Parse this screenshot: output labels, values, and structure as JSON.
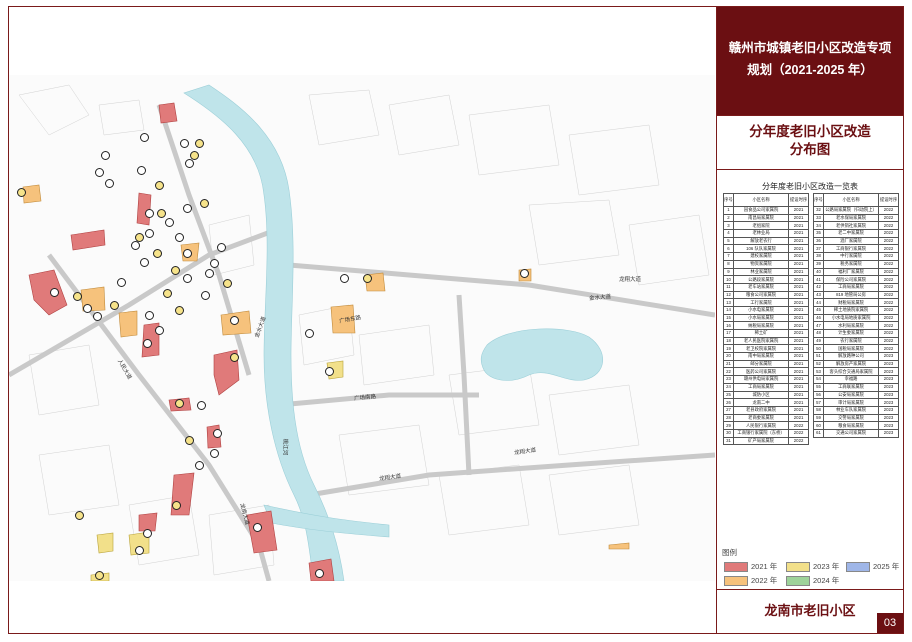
{
  "header": {
    "title": "赣州市城镇老旧小区改造专项规划（2021-2025 年）",
    "subtitle_line1": "分年度老旧小区改造",
    "subtitle_line2": "分布图"
  },
  "table": {
    "caption": "分年度老旧小区改造一览表",
    "col_no": "序号",
    "col_name": "小区名称",
    "col_year": "提设时序",
    "left_rows": [
      [
        "1",
        "园食品公司家属院",
        "2021"
      ],
      [
        "2",
        "南昌局家属院",
        "2021"
      ],
      [
        "3",
        "老组家院",
        "2021"
      ],
      [
        "4",
        "老林业局",
        "2021"
      ],
      [
        "5",
        "解放老农行",
        "2021"
      ],
      [
        "6",
        "106 队队家属院",
        "2021"
      ],
      [
        "7",
        "建校家属院",
        "2021"
      ],
      [
        "8",
        "物资家属院",
        "2021"
      ],
      [
        "9",
        "林业家属院",
        "2021"
      ],
      [
        "10",
        "公路段家属院",
        "2021"
      ],
      [
        "11",
        "老车站家属院",
        "2021"
      ],
      [
        "12",
        "粮食公司家属院",
        "2021"
      ],
      [
        "13",
        "工行家属院",
        "2021"
      ],
      [
        "14",
        "小水电家属院",
        "2021"
      ],
      [
        "15",
        "小水局家属院",
        "2021"
      ],
      [
        "16",
        "纳税局家属院",
        "2021"
      ],
      [
        "17",
        "稀土矿",
        "2021"
      ],
      [
        "18",
        "老人民医院家属院",
        "2021"
      ],
      [
        "19",
        "老卫校院家属院",
        "2021"
      ],
      [
        "20",
        "南中局家属院",
        "2021"
      ],
      [
        "21",
        "邮分家属院",
        "2021"
      ],
      [
        "22",
        "医药公司家属院",
        "2021"
      ],
      [
        "23",
        "赣州供电局家属院",
        "2021"
      ],
      [
        "24",
        "工商局家属院",
        "2021"
      ],
      [
        "25",
        "城防小区",
        "2021"
      ],
      [
        "26",
        "龙南二中",
        "2021"
      ],
      [
        "27",
        "老县政府家属院",
        "2021"
      ],
      [
        "28",
        "老商委家属院",
        "2021"
      ],
      [
        "29",
        "人民银行家属院",
        "2022"
      ],
      [
        "30",
        "工商银行家属院（东桥）",
        "2022"
      ],
      [
        "31",
        "矿产局家属院",
        "2022"
      ]
    ],
    "right_rows": [
      [
        "32",
        "公路局家属院（归动院上）",
        "2022"
      ],
      [
        "33",
        "老水保局家属院",
        "2022"
      ],
      [
        "34",
        "老供销社家属院",
        "2022"
      ],
      [
        "35",
        "老二中家属院",
        "2022"
      ],
      [
        "36",
        "酒厂家属院",
        "2022"
      ],
      [
        "37",
        "工商银行家属院",
        "2022"
      ],
      [
        "38",
        "中行家属院",
        "2022"
      ],
      [
        "39",
        "税务家属院",
        "2022"
      ],
      [
        "40",
        "福利厂家属院",
        "2022"
      ],
      [
        "41",
        "保险公司家属院",
        "2022"
      ],
      [
        "42",
        "工商局家属院",
        "2022"
      ],
      [
        "43",
        "819 地管局公房",
        "2022"
      ],
      [
        "44",
        "财税局家属院",
        "2022"
      ],
      [
        "45",
        "稀土地质院家属院",
        "2022"
      ],
      [
        "46",
        "小水电局地质家属院",
        "2022"
      ],
      [
        "47",
        "水利局家属院",
        "2022"
      ],
      [
        "48",
        "计生委家属院",
        "2022"
      ],
      [
        "49",
        "农行家属院",
        "2022"
      ],
      [
        "50",
        "国税局家属院",
        "2022"
      ],
      [
        "51",
        "解放路种公司",
        "2023"
      ],
      [
        "52",
        "解放房产家属院",
        "2023"
      ],
      [
        "53",
        "客头综合交通局家属院",
        "2023"
      ],
      [
        "54",
        "幸福路",
        "2023"
      ],
      [
        "55",
        "工商联家属院",
        "2023"
      ],
      [
        "56",
        "公安局家属院",
        "2023"
      ],
      [
        "57",
        "审计局家属院",
        "2023"
      ],
      [
        "58",
        "林业车队家属院",
        "2023"
      ],
      [
        "59",
        "交警局家属院",
        "2023"
      ],
      [
        "60",
        "粮食局家属院",
        "2023"
      ],
      [
        "61",
        "交通公司家属院",
        "2023"
      ]
    ]
  },
  "legend": {
    "title": "图例",
    "items": [
      {
        "label": "2021 年",
        "color": "#e07a7a"
      },
      {
        "label": "2023 年",
        "color": "#f2e08a"
      },
      {
        "label": "2025 年",
        "color": "#9fb6e8"
      },
      {
        "label": "2022 年",
        "color": "#f6c27c"
      },
      {
        "label": "2024 年",
        "color": "#9ed39a"
      }
    ]
  },
  "map": {
    "road_labels": [
      "龙翔大道",
      "龙翔大道",
      "广场南路",
      "广场东路",
      "金水大道",
      "金水大道",
      "桃江河",
      "人民大道",
      "龙南大道",
      "龙翔大道"
    ]
  },
  "footer": {
    "name": "龙南市老旧小区",
    "page": "03"
  },
  "colors": {
    "accent": "#6b0f12",
    "river": "#bfe4ea",
    "y2021": "#e07a7a",
    "y2022": "#f6c27c",
    "y2023": "#f2e08a"
  }
}
